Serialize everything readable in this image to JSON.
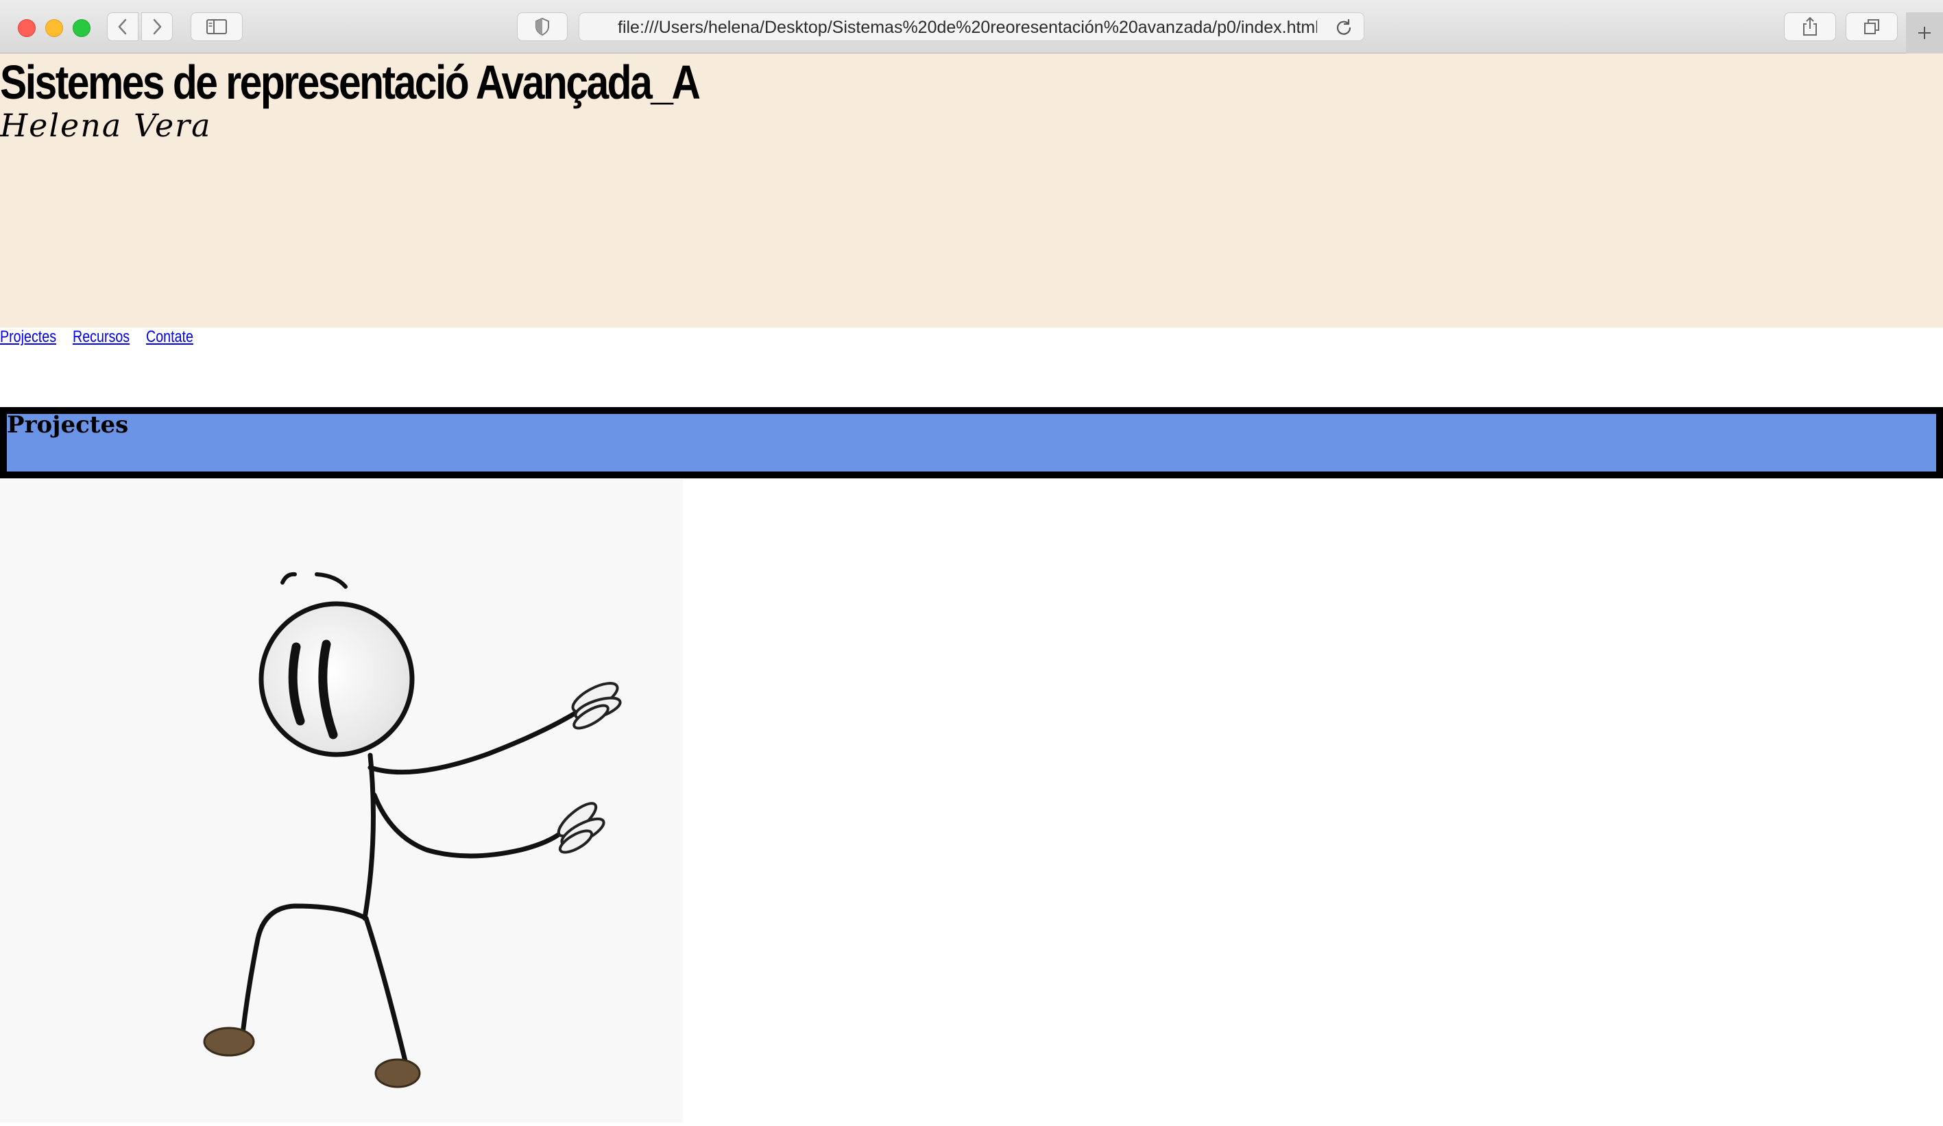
{
  "browser": {
    "url": "file:///Users/helena/Desktop/Sistemas%20de%20reoresentación%20avanzada/p0/index.html",
    "icons": [
      "close-button",
      "minimize-button",
      "maximize-button",
      "back-icon",
      "forward-icon",
      "sidebar-icon",
      "shield-icon",
      "reload-icon",
      "share-icon",
      "tabs-icon",
      "plus-icon"
    ]
  },
  "header": {
    "title": "Sistemes de representació Avançada_A",
    "author": "Helena Vera",
    "background": "#f7ebdb"
  },
  "nav": {
    "links": [
      {
        "label": "Projectes"
      },
      {
        "label": "Recursos"
      },
      {
        "label": "Contate"
      }
    ]
  },
  "section": {
    "title": "Projectes",
    "background": "#6b93e6",
    "border": "#000000"
  },
  "figure": {
    "subject": "stick-figure-illustration"
  }
}
